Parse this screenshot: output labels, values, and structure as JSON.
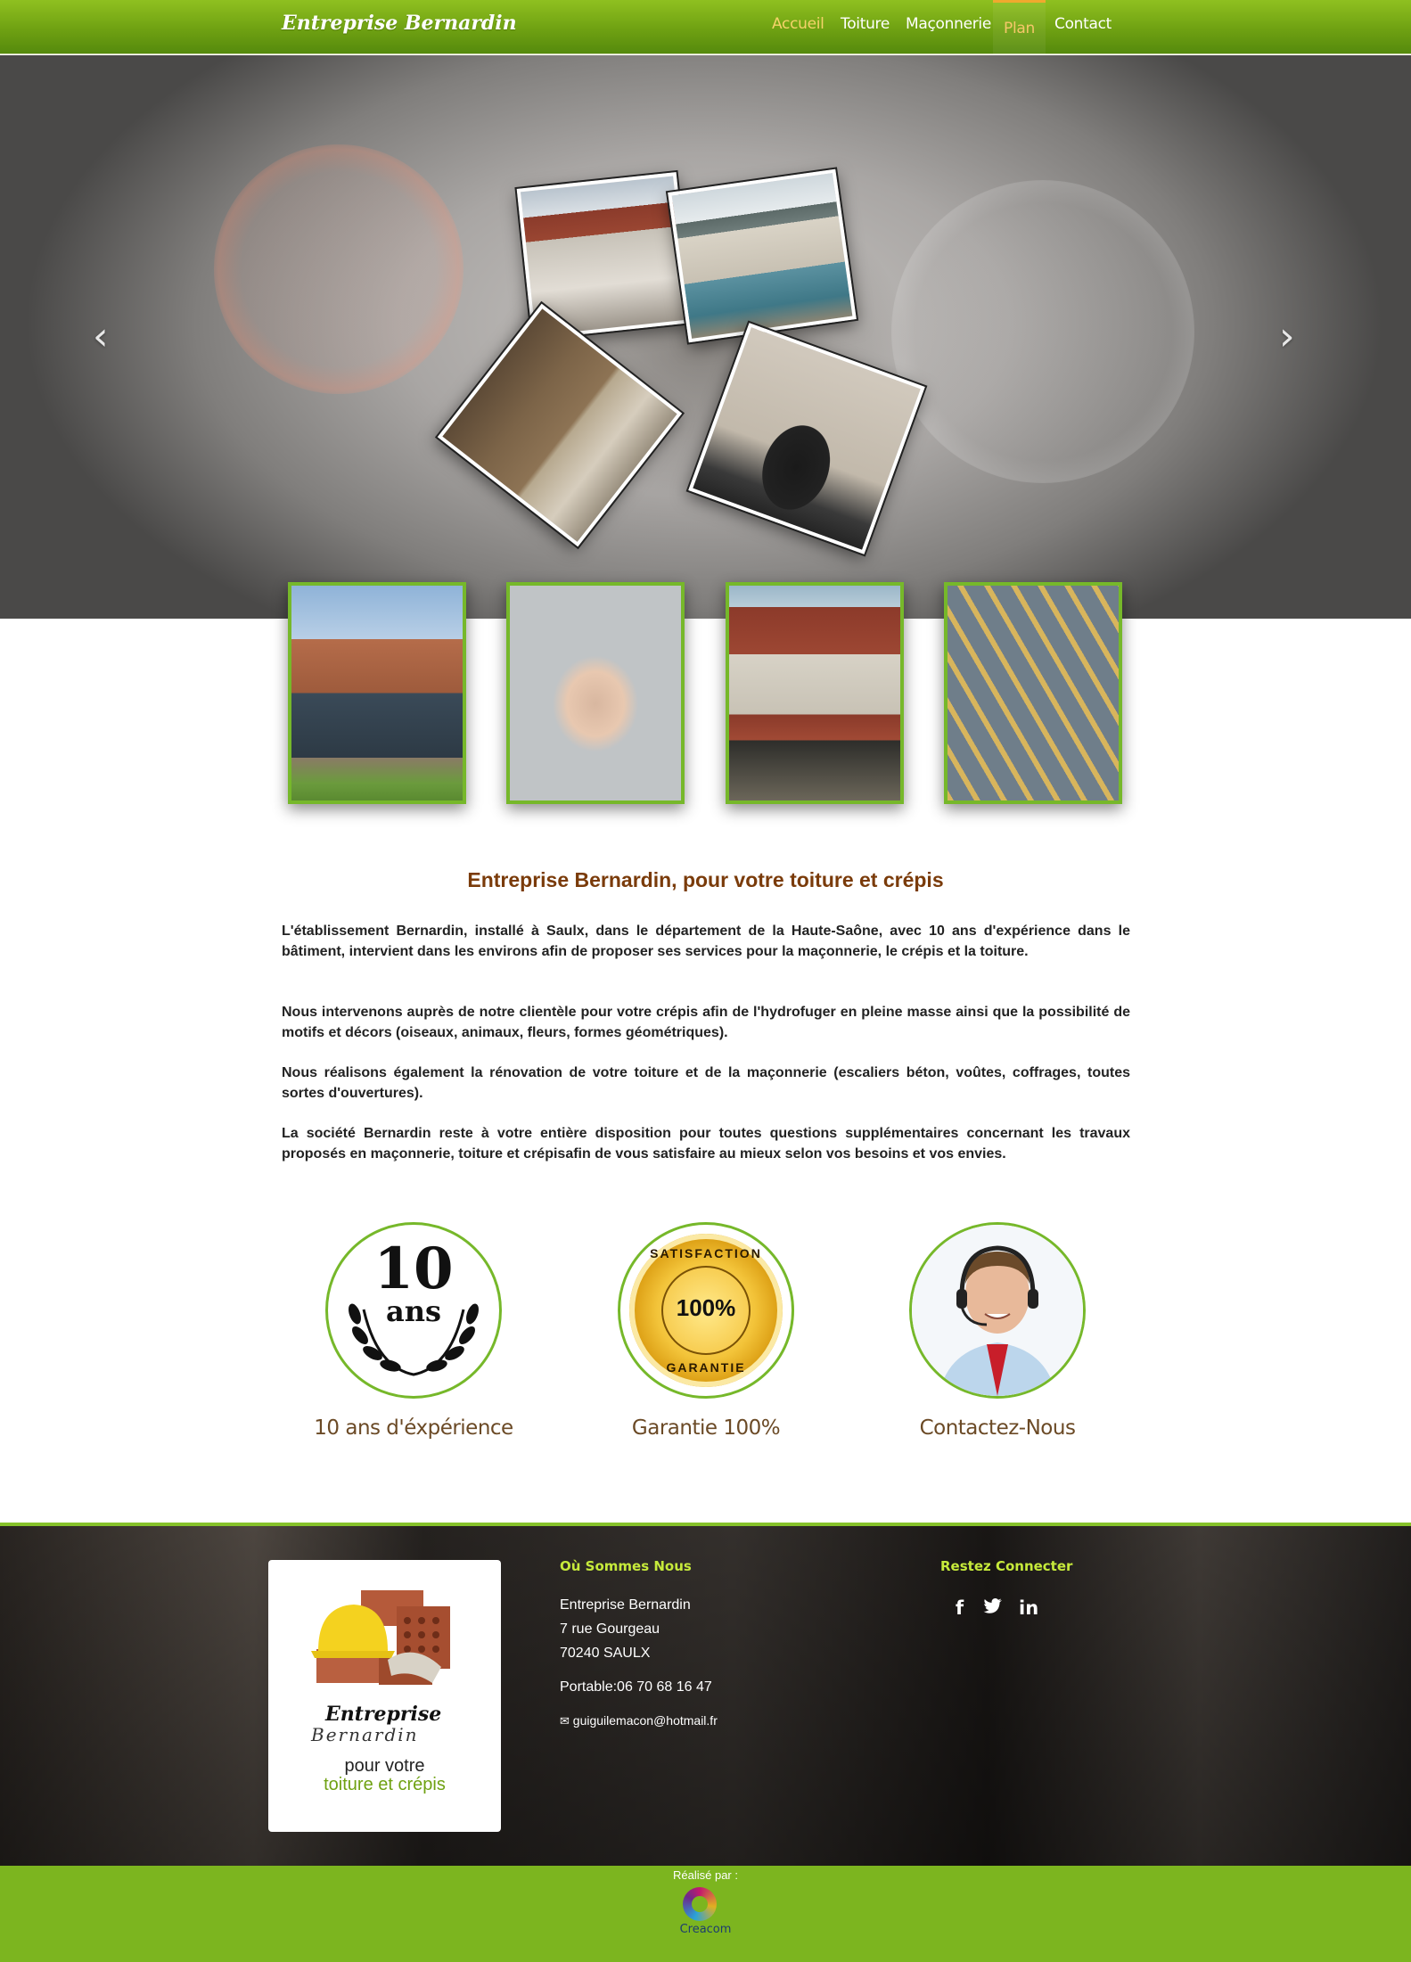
{
  "brand": "Entreprise Bernardin",
  "nav": {
    "items": [
      {
        "label": "Accueil",
        "state": "active"
      },
      {
        "label": "Toiture",
        "state": "normal"
      },
      {
        "label": "Maçonnerie",
        "state": "normal"
      },
      {
        "label": "Plan",
        "state": "highlighted"
      },
      {
        "label": "Contact",
        "state": "normal"
      }
    ]
  },
  "carousel": {
    "prev_icon": "chevron-left-icon",
    "next_icon": "chevron-right-icon",
    "prev_glyph": "‹",
    "next_glyph": "›"
  },
  "content": {
    "title": "Entreprise Bernardin, pour votre toiture et crépis",
    "paragraphs": [
      "L'établissement Bernardin, installé à Saulx, dans le département de la Haute-Saône, avec 10 ans d'expérience dans le bâtiment, intervient dans les environs afin de proposer ses services pour la maçonnerie, le crépis et la toiture.",
      "Nous intervenons auprès de notre clientèle pour votre crépis afin de l'hydrofuger en pleine masse ainsi que la possibilité de motifs et décors (oiseaux, animaux, fleurs, formes géométriques).",
      "Nous réalisons également la rénovation de votre toiture et de la maçonnerie (escaliers béton, voûtes, coffrages, toutes sortes d'ouvertures).",
      "La société Bernardin reste à votre entière disposition pour toutes questions supplémentaires concernant les travaux proposés en maçonnerie, toiture et crépisafin de vous satisfaire au mieux selon vos besoins et vos envies."
    ]
  },
  "features": [
    {
      "label": "10 ans d'éxpérience",
      "badge_number": "10",
      "badge_word": "ans"
    },
    {
      "label": "Garantie 100%",
      "seal_top": "SATISFACTION",
      "seal_center": "100%",
      "seal_bottom": "GARANTIE"
    },
    {
      "label": "Contactez-Nous"
    }
  ],
  "footer": {
    "logo": {
      "line1": "Entreprise",
      "line2": "Bernardin",
      "tag1": "pour votre",
      "tag2": "toiture et crépis"
    },
    "where_heading": "Où Sommes Nous",
    "name": "Entreprise Bernardin",
    "street": "7 rue Gourgeau",
    "city": "70240 SAULX",
    "phone": "Portable:06 70 68 16 47",
    "email_icon": "envelope-icon",
    "email": "guiguilemacon@hotmail.fr",
    "connect_heading": "Restez Connecter",
    "social": [
      {
        "icon": "facebook-icon",
        "glyph": "f"
      },
      {
        "icon": "twitter-icon",
        "glyph": "t"
      },
      {
        "icon": "linkedin-icon",
        "glyph": "in"
      }
    ]
  },
  "credit": {
    "label": "Réalisé par :",
    "logo_text": "Creacom"
  },
  "colors": {
    "accent_green": "#76b82a",
    "nav_active": "#f5d36a",
    "title_brown": "#7a3b0a",
    "footer_heading": "#c6ea3b"
  }
}
